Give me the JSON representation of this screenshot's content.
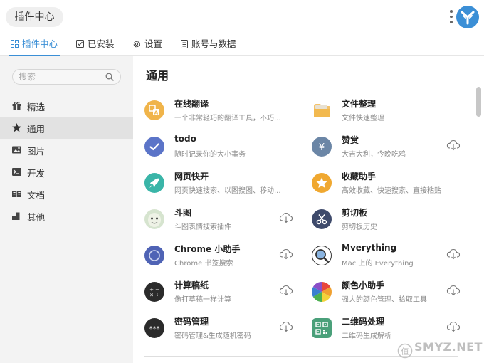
{
  "window": {
    "title": "插件中心"
  },
  "tabs": [
    {
      "label": "插件中心"
    },
    {
      "label": "已安装"
    },
    {
      "label": "设置"
    },
    {
      "label": "账号与数据"
    }
  ],
  "sidebar": {
    "search_placeholder": "搜索",
    "items": [
      {
        "label": "精选",
        "icon": "gift-icon"
      },
      {
        "label": "通用",
        "icon": "star-icon"
      },
      {
        "label": "图片",
        "icon": "image-icon"
      },
      {
        "label": "开发",
        "icon": "terminal-icon"
      },
      {
        "label": "文档",
        "icon": "book-icon"
      },
      {
        "label": "其他",
        "icon": "blocks-icon"
      }
    ],
    "active_index": 1
  },
  "main": {
    "section_title": "通用",
    "plugins": [
      {
        "name": "在线翻译",
        "desc": "一个非常轻巧的翻译工具，不巧...",
        "icon": "translate-icon",
        "color": "#f0b44a",
        "downloadable": false
      },
      {
        "name": "文件整理",
        "desc": "文件快速整理",
        "icon": "folder-icon",
        "color": "#f4c26a",
        "downloadable": false
      },
      {
        "name": "todo",
        "desc": "随时记录你的大小事务",
        "icon": "check-icon",
        "color": "#5b74c8",
        "downloadable": false
      },
      {
        "name": "赞赏",
        "desc": "大吉大利，今晚吃鸡",
        "icon": "yen-icon",
        "color": "#6b86a6",
        "downloadable": true
      },
      {
        "name": "网页快开",
        "desc": "网页快速搜索、以图搜图、移动...",
        "icon": "rocket-icon",
        "color": "#3ab5a8",
        "downloadable": false
      },
      {
        "name": "收藏助手",
        "desc": "高效收藏、快速搜索、直接粘贴",
        "icon": "bookmark-star-icon",
        "color": "#f0a830",
        "downloadable": false
      },
      {
        "name": "斗图",
        "desc": "斗图表情搜索插件",
        "icon": "meme-face-icon",
        "color": "#c7dcc0",
        "downloadable": true
      },
      {
        "name": "剪切板",
        "desc": "剪切板历史",
        "icon": "clipboard-icon",
        "color": "#3e4a6b",
        "downloadable": false
      },
      {
        "name": "Chrome 小助手",
        "desc": "Chrome 书签搜索",
        "icon": "chrome-circle-icon",
        "color": "#4f63b5",
        "downloadable": true
      },
      {
        "name": "Mverything",
        "desc": "Mac 上的 Everything",
        "icon": "magnifier-icon",
        "color": "#3d6fb0",
        "downloadable": true
      },
      {
        "name": "计算稿纸",
        "desc": "像打草稿一样计算",
        "icon": "calculator-icon",
        "color": "#2b2b2b",
        "downloadable": true
      },
      {
        "name": "颜色小助手",
        "desc": "强大的颜色管理、拾取工具",
        "icon": "color-wheel-icon",
        "color": "#e85a4f",
        "downloadable": true
      },
      {
        "name": "密码管理",
        "desc": "密码管理&生成随机密码",
        "icon": "password-dots-icon",
        "color": "#2b2b2b",
        "downloadable": true
      },
      {
        "name": "二维码处理",
        "desc": "二维码生成解析",
        "icon": "qrcode-icon",
        "color": "#4aa07a",
        "downloadable": true
      }
    ]
  },
  "watermark": {
    "text": "SMYZ.NET"
  },
  "colors": {
    "accent": "#3b8fd6",
    "sidebar_bg": "#f3f3f3",
    "active_item_bg": "#e2e2e2"
  }
}
